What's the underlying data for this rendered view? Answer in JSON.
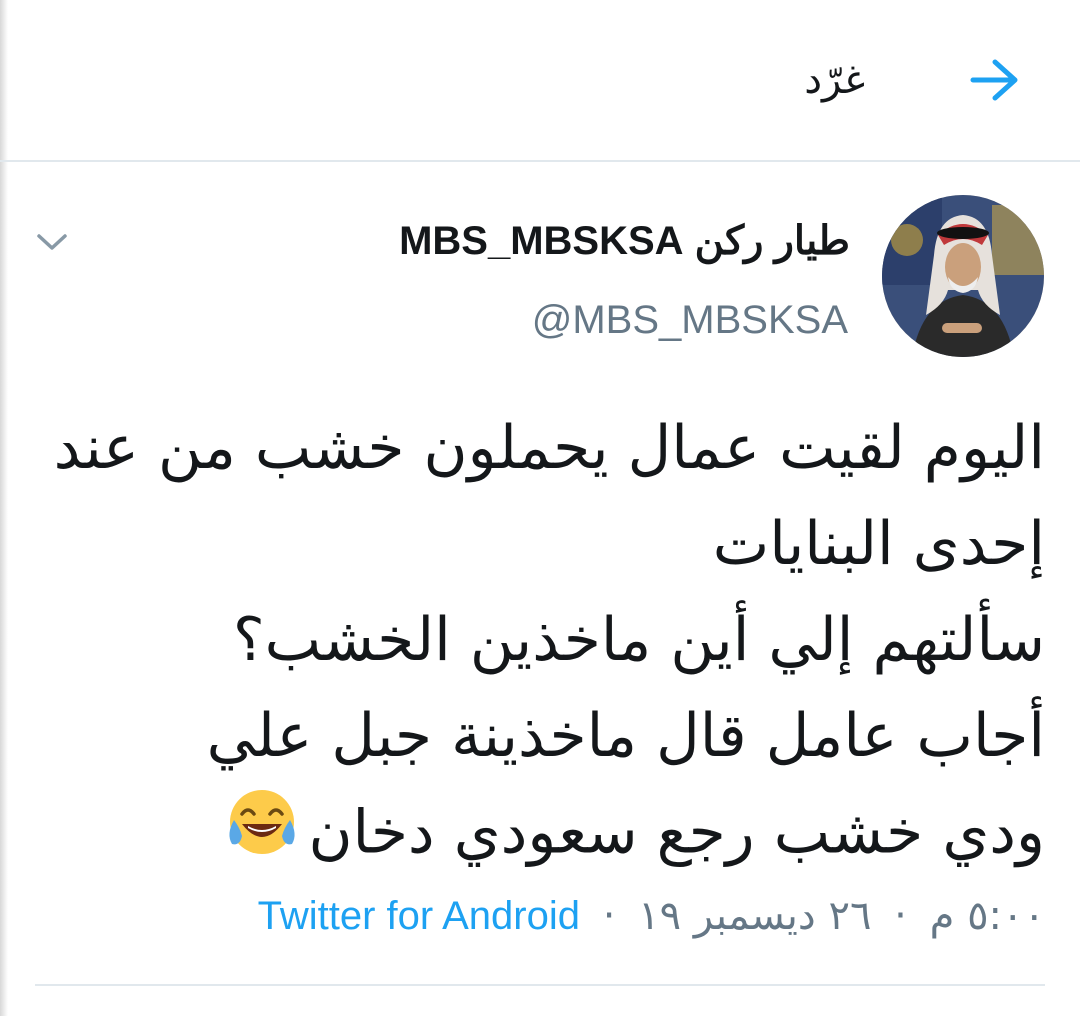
{
  "header": {
    "title": "غرّد",
    "back_icon": "arrow-right-icon",
    "accent_color": "#1da1f2"
  },
  "tweet": {
    "display_name": "طيار ركن MBS_MBSKSA",
    "handle": "@MBS_MBSKSA",
    "text_lines": [
      "اليوم لقيت عمال يحملون خشب من عند",
      "إحدى البنايات",
      "سألتهم إلي أين ماخذين الخشب؟",
      "أجاب عامل قال ماخذينة جبل علي",
      "ودي خشب رجع سعودي دخان"
    ],
    "emoji": "face-with-tears-of-joy-icon",
    "time": "٥:٠٠ م",
    "date": "٢٦ ديسمبر ١٩",
    "separator": "·",
    "source": "Twitter for Android",
    "menu_icon": "chevron-down-icon",
    "avatar": "avatar-image"
  },
  "colors": {
    "text_primary": "#14171a",
    "text_secondary": "#657786",
    "link": "#1da1f2",
    "divider": "#e1e8ed"
  }
}
